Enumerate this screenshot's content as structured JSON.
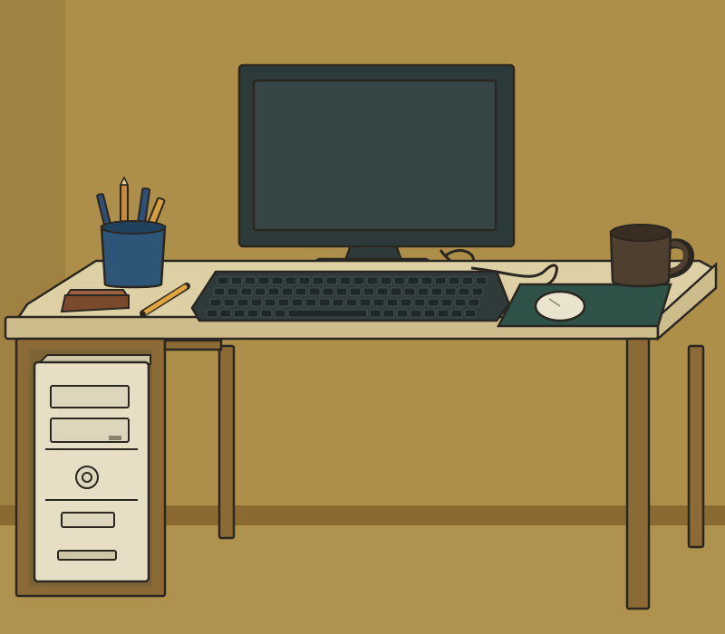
{
  "scene": {
    "subject": "computer desk",
    "colors": {
      "wall": "#ad8f4a",
      "wall_shadow": "#8f7437",
      "floor": "#b0924f",
      "baseboard": "#8a6a30",
      "desktop": "#ddd0a4",
      "desk_edge": "#cdbd8c",
      "desk_frame": "#8c6a36",
      "monitor": "#2c3a3a",
      "screen": "#364545",
      "keyboard": "#2f3b3b",
      "mousepad": "#2e5148",
      "mouse": "#eae3ce",
      "tower": "#e6dfc6",
      "pen_cup": "#2c5577",
      "mug": "#4f3f30",
      "outline": "#2a2620"
    },
    "objects": {
      "monitor": "monitor",
      "keyboard": "keyboard",
      "mouse": "mouse",
      "mousepad": "mousepad",
      "tower": "computer-tower",
      "pen_cup": "pen-cup",
      "pencil": "pencil",
      "eraser": "eraser",
      "mug": "coffee-mug"
    }
  }
}
